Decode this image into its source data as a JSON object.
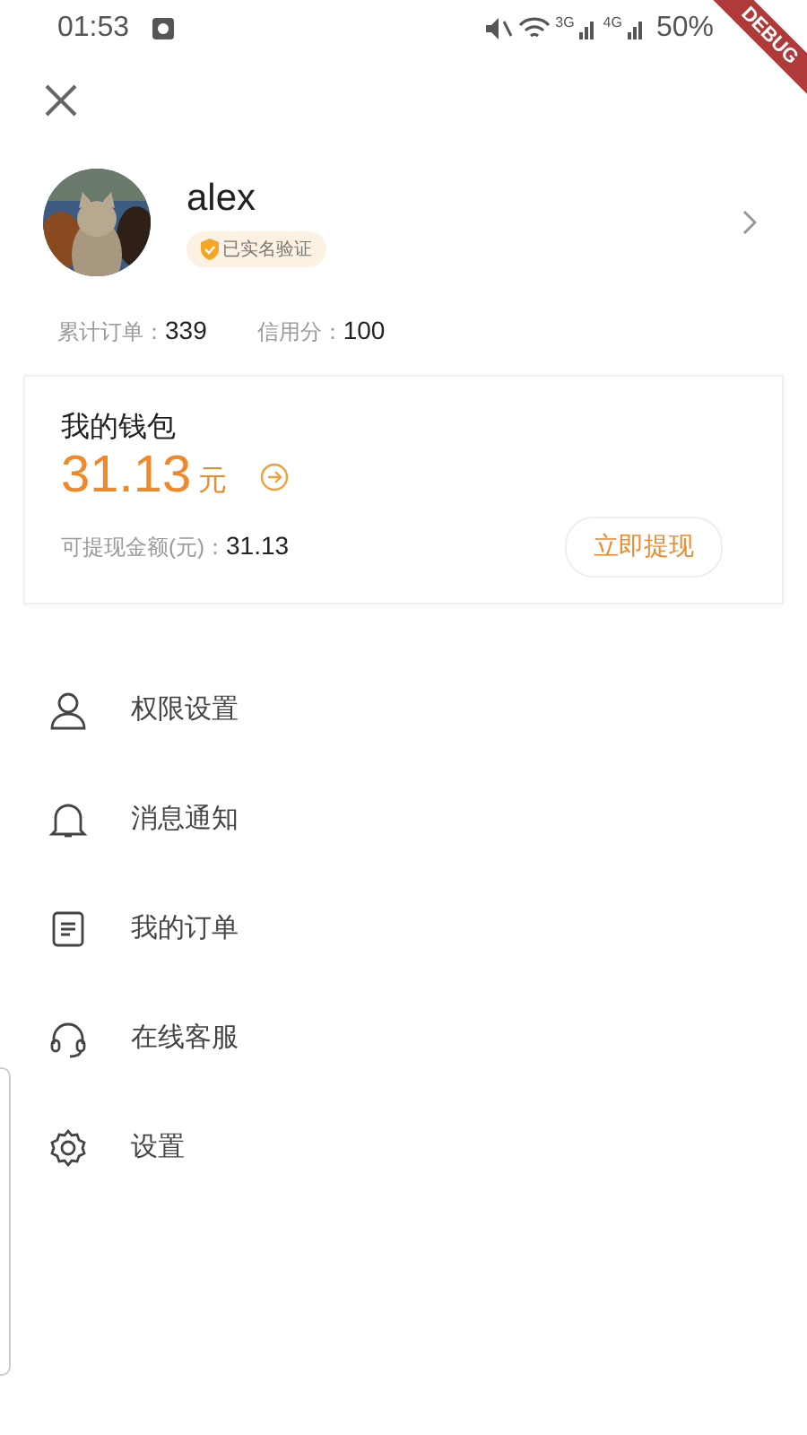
{
  "status_bar": {
    "time": "01:53",
    "network_3g": "3G",
    "network_4g": "4G",
    "battery": "50%"
  },
  "debug_banner": "DEBUG",
  "profile": {
    "name": "alex",
    "badge": "已实名验证"
  },
  "stats": [
    {
      "label": "累计订单：",
      "value": "339"
    },
    {
      "label": "信用分：",
      "value": "100"
    }
  ],
  "wallet": {
    "title": "我的钱包",
    "amount": "31.13",
    "unit": "元",
    "withdrawable_label": "可提现金额(元)：",
    "withdrawable_value": "31.13",
    "button": "立即提现"
  },
  "menu": [
    {
      "label": "权限设置"
    },
    {
      "label": "消息通知"
    },
    {
      "label": "我的订单"
    },
    {
      "label": "在线客服"
    },
    {
      "label": "设置"
    }
  ]
}
